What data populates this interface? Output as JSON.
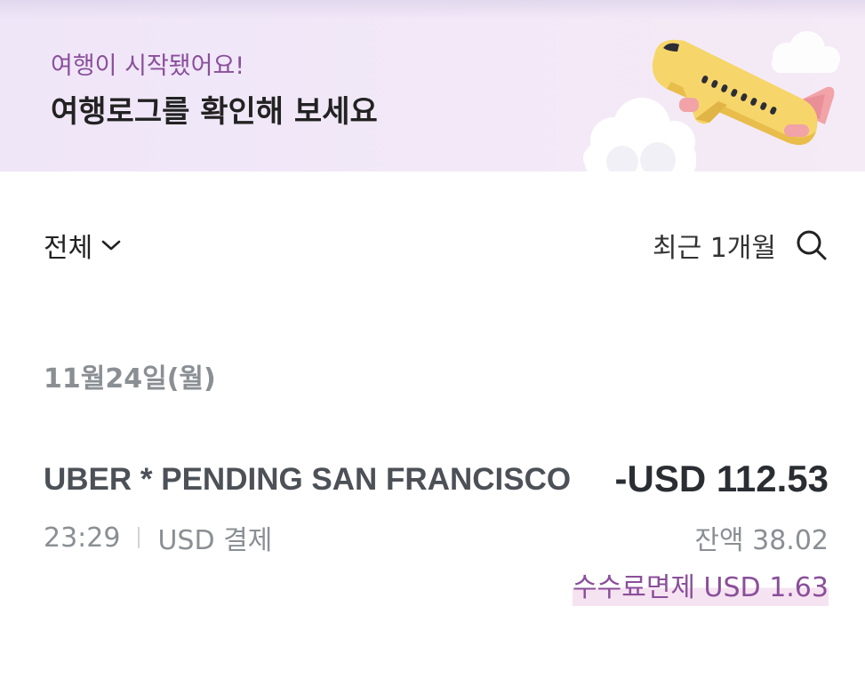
{
  "banner": {
    "subtitle": "여행이 시작됐어요!",
    "title": "여행로그를 확인해 보세요",
    "illustration": "airplane-with-clouds"
  },
  "filters": {
    "category_label": "전체",
    "period_label": "최근 1개월",
    "icons": {
      "dropdown": "chevron-down-icon",
      "search": "search-icon"
    }
  },
  "transactions": {
    "date": "11월24일(월)",
    "items": [
      {
        "merchant": "UBER * PENDING SAN FRANCISCO",
        "amount": "-USD 112.53",
        "time": "23:29",
        "type": "USD 결제",
        "balance": "잔액 38.02",
        "fee": "수수료면제 USD 1.63"
      }
    ]
  },
  "colors": {
    "accent_purple": "#8a4f9a",
    "banner_bg": "#efe6f8",
    "plane_yellow": "#f6d66a",
    "plane_pink": "#f1a3a8"
  }
}
